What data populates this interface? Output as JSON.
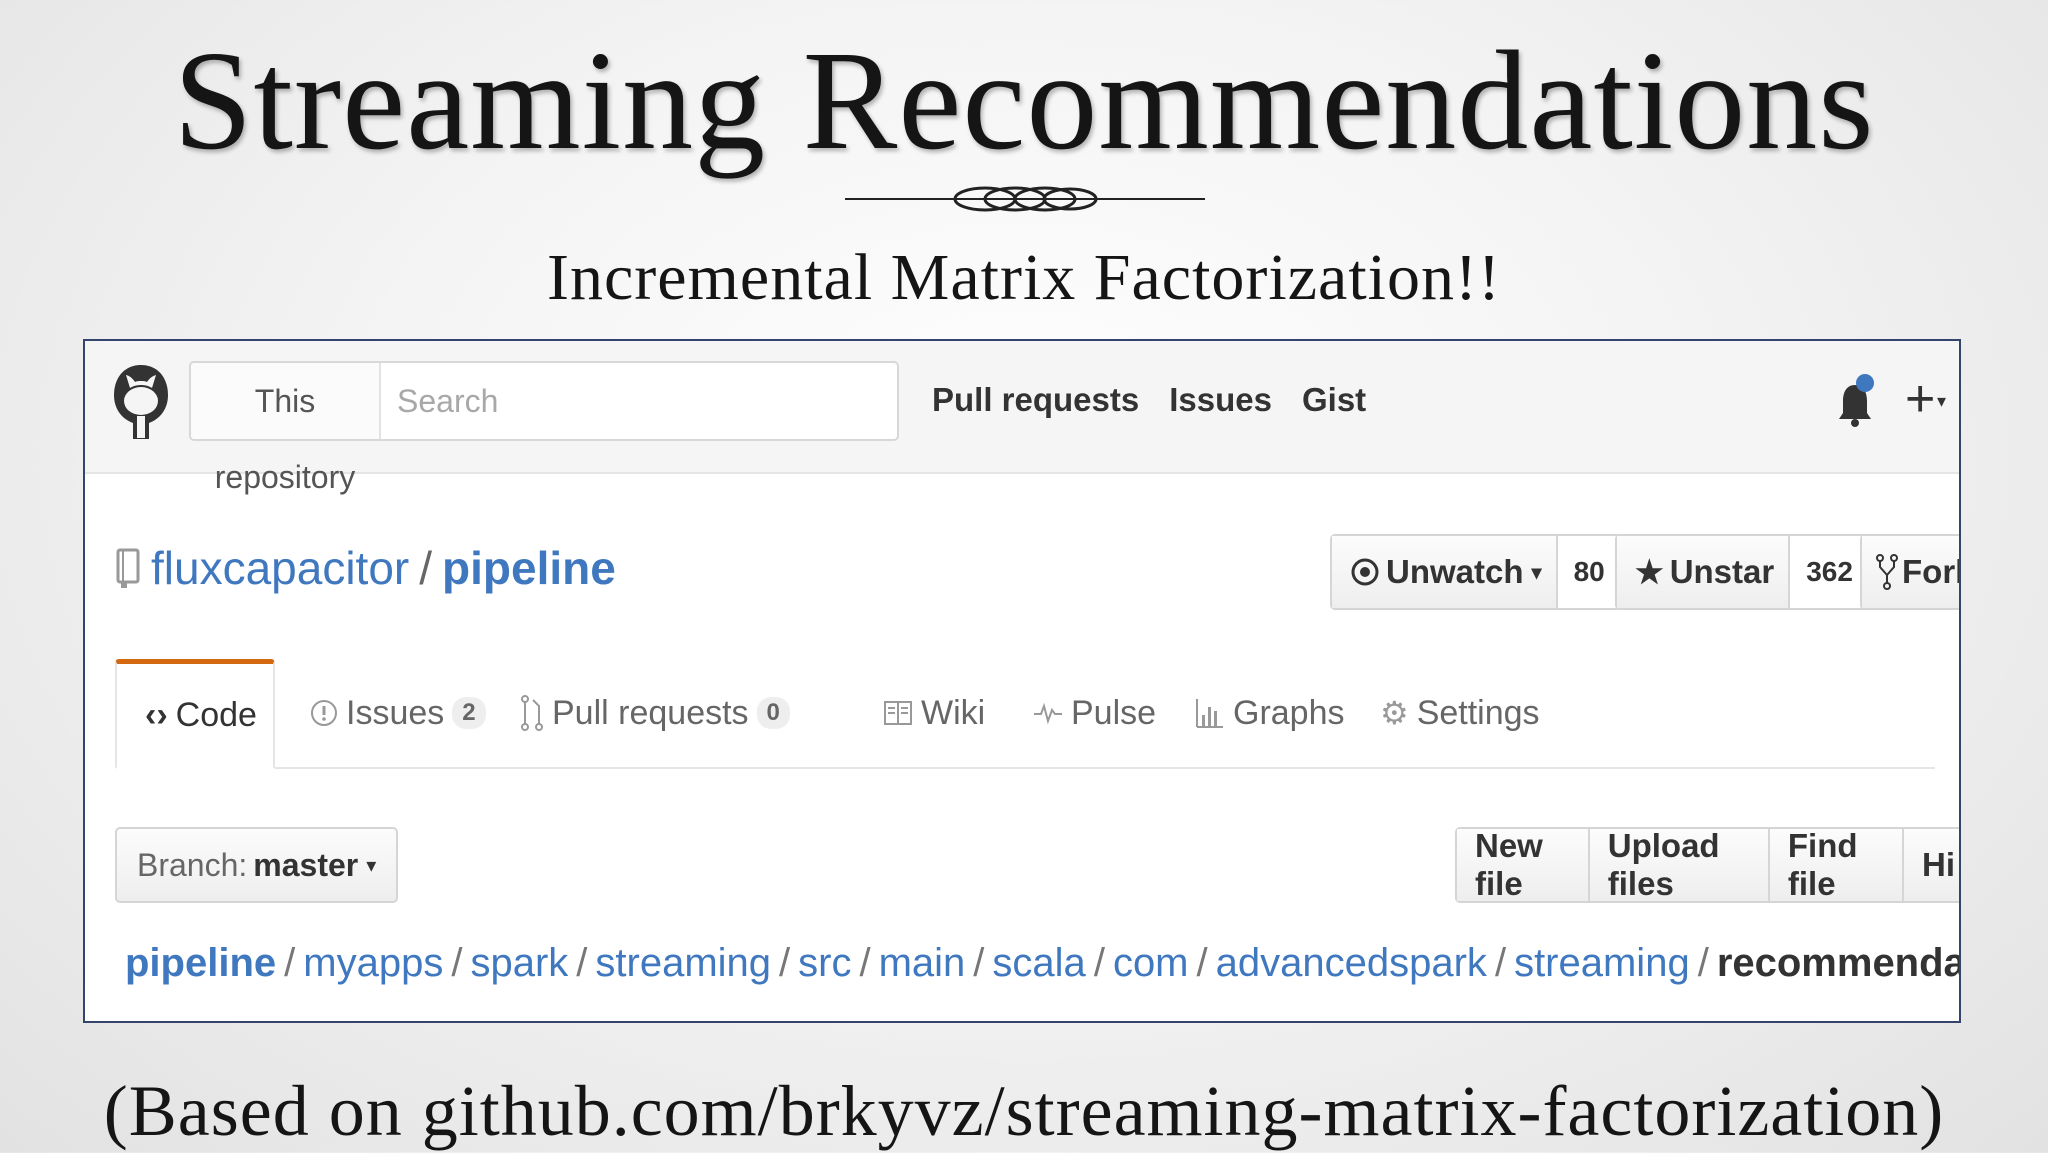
{
  "slide": {
    "title": "Streaming Recommendations",
    "subtitle": "Incremental Matrix Factorization!!",
    "footer": "(Based on github.com/brkyvz/streaming-matrix-factorization)"
  },
  "header": {
    "scope_label": "This repository",
    "search_placeholder": "Search",
    "nav": [
      "Pull requests",
      "Issues",
      "Gist"
    ],
    "plus_label": "+"
  },
  "repo": {
    "owner": "fluxcapacitor",
    "separator": "/",
    "name": "pipeline",
    "unwatch": {
      "label": "Unwatch",
      "count": "80"
    },
    "unstar": {
      "label": "Unstar",
      "count": "362"
    },
    "fork": {
      "label": "Fork"
    }
  },
  "tabs": {
    "code": "Code",
    "issues": {
      "label": "Issues",
      "count": "2"
    },
    "pulls": {
      "label": "Pull requests",
      "count": "0"
    },
    "wiki": "Wiki",
    "pulse": "Pulse",
    "graphs": "Graphs",
    "settings": "Settings"
  },
  "branch": {
    "prefix": "Branch:",
    "name": "master"
  },
  "file_actions": [
    "New file",
    "Upload files",
    "Find file",
    "Hi"
  ],
  "breadcrumb": [
    "pipeline",
    "myapps",
    "spark",
    "streaming",
    "src",
    "main",
    "scala",
    "com",
    "advancedspark",
    "streaming",
    "recommendation"
  ],
  "colors": {
    "link": "#4078c0",
    "tab_accent": "#d26911",
    "frame": "#33456d"
  }
}
